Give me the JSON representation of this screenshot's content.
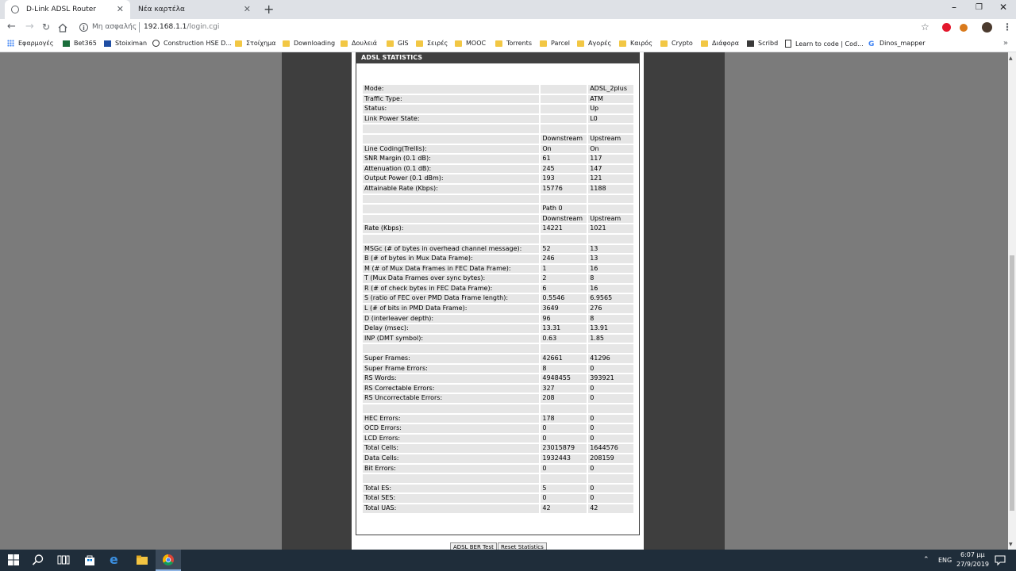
{
  "browser": {
    "tabs": [
      {
        "title": "D-Link ADSL Router"
      },
      {
        "title": "Νέα καρτέλα"
      }
    ],
    "address": {
      "security_label": "Μη ασφαλής",
      "host": "192.168.1.1",
      "path": "/login.cgi"
    },
    "bookmarks": [
      {
        "label": "Εφαρμογές",
        "icon": "apps-icon"
      },
      {
        "label": "Bet365",
        "icon": "bet365-icon"
      },
      {
        "label": "Stoiximan",
        "icon": "stoiximan-icon"
      },
      {
        "label": "Construction HSE D...",
        "icon": "globe-icon"
      },
      {
        "label": "Στοίχημα",
        "icon": "folder-icon"
      },
      {
        "label": "Downloading",
        "icon": "folder-icon"
      },
      {
        "label": "Δουλειά",
        "icon": "folder-icon"
      },
      {
        "label": "GIS",
        "icon": "folder-icon"
      },
      {
        "label": "Σειρές",
        "icon": "folder-icon"
      },
      {
        "label": "MOOC",
        "icon": "folder-icon"
      },
      {
        "label": "Torrents",
        "icon": "folder-icon"
      },
      {
        "label": "Parcel",
        "icon": "folder-icon"
      },
      {
        "label": "Αγορές",
        "icon": "folder-icon"
      },
      {
        "label": "Καιρός",
        "icon": "folder-icon"
      },
      {
        "label": "Crypto",
        "icon": "folder-icon"
      },
      {
        "label": "Διάφορα",
        "icon": "folder-icon"
      },
      {
        "label": "Scribd",
        "icon": "scribd-icon"
      },
      {
        "label": "Learn to code | Cod...",
        "icon": "codecademy-icon"
      },
      {
        "label": "Dinos_mapper",
        "icon": "google-icon"
      }
    ]
  },
  "page": {
    "section_title": "ADSL STATISTICS",
    "rows": [
      [
        "Mode:",
        "",
        "ADSL_2plus"
      ],
      [
        "Traffic Type:",
        "",
        "ATM"
      ],
      [
        "Status:",
        "",
        "Up"
      ],
      [
        "Link Power State:",
        "",
        "L0"
      ],
      [
        "",
        "",
        ""
      ],
      [
        "",
        "Downstream",
        "Upstream"
      ],
      [
        "Line Coding(Trellis):",
        "On",
        "On"
      ],
      [
        "SNR Margin (0.1 dB):",
        "61",
        "117"
      ],
      [
        "Attenuation (0.1 dB):",
        "245",
        "147"
      ],
      [
        "Output Power (0.1 dBm):",
        "193",
        "121"
      ],
      [
        "Attainable Rate (Kbps):",
        "15776",
        "1188"
      ],
      [
        "",
        "",
        ""
      ],
      [
        "",
        "Path 0",
        ""
      ],
      [
        "",
        "Downstream",
        "Upstream"
      ],
      [
        "Rate (Kbps):",
        "14221",
        "1021"
      ],
      [
        "",
        "",
        ""
      ],
      [
        "MSGc (# of bytes in overhead channel message):",
        "52",
        "13"
      ],
      [
        "B (# of bytes in Mux Data Frame):",
        "246",
        "13"
      ],
      [
        "M (# of Mux Data Frames in FEC Data Frame):",
        "1",
        "16"
      ],
      [
        "T (Mux Data Frames over sync bytes):",
        "2",
        "8"
      ],
      [
        "R (# of check bytes in FEC Data Frame):",
        "6",
        "16"
      ],
      [
        "S (ratio of FEC over PMD Data Frame length):",
        "0.5546",
        "6.9565"
      ],
      [
        "L (# of bits in PMD Data Frame):",
        "3649",
        "276"
      ],
      [
        "D (interleaver depth):",
        "96",
        "8"
      ],
      [
        "Delay (msec):",
        "13.31",
        "13.91"
      ],
      [
        "INP (DMT symbol):",
        "0.63",
        "1.85"
      ],
      [
        "",
        "",
        ""
      ],
      [
        "Super Frames:",
        "42661",
        "41296"
      ],
      [
        "Super Frame Errors:",
        "8",
        "0"
      ],
      [
        "RS Words:",
        "4948455",
        "393921"
      ],
      [
        "RS Correctable Errors:",
        "327",
        "0"
      ],
      [
        "RS Uncorrectable Errors:",
        "208",
        "0"
      ],
      [
        "",
        "",
        ""
      ],
      [
        "HEC Errors:",
        "178",
        "0"
      ],
      [
        "OCD Errors:",
        "0",
        "0"
      ],
      [
        "LCD Errors:",
        "0",
        "0"
      ],
      [
        "Total Cells:",
        "23015879",
        "1644576"
      ],
      [
        "Data Cells:",
        "1932443",
        "208159"
      ],
      [
        "Bit Errors:",
        "0",
        "0"
      ],
      [
        "",
        "",
        ""
      ],
      [
        "Total ES:",
        "5",
        "0"
      ],
      [
        "Total SES:",
        "0",
        "0"
      ],
      [
        "Total UAS:",
        "42",
        "42"
      ]
    ],
    "buttons": {
      "ber_test": "ADSL BER Test",
      "reset": "Reset Statistics"
    }
  },
  "taskbar": {
    "language": "ENG",
    "time": "6:07 μμ",
    "date": "27/9/2019"
  }
}
